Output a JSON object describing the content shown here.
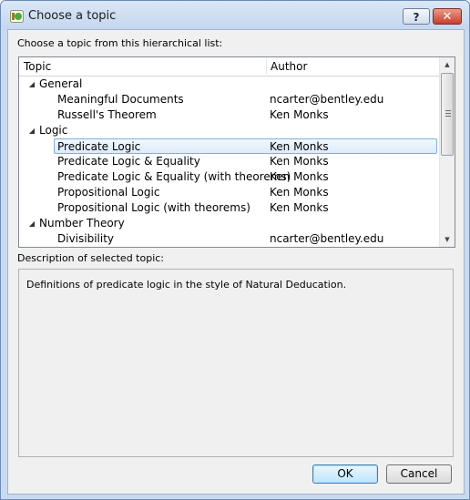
{
  "window": {
    "title": "Choose a topic",
    "help_glyph": "?",
    "close_glyph": "✕",
    "icon": "app-logo-icon"
  },
  "tree": {
    "prompt": "Choose a topic from this hierarchical list:",
    "columns": [
      "Topic",
      "Author"
    ],
    "rows": [
      {
        "type": "group",
        "topic": "General",
        "author": "",
        "expanded": true
      },
      {
        "type": "item",
        "topic": "Meaningful Documents",
        "author": "ncarter@bentley.edu"
      },
      {
        "type": "item",
        "topic": "Russell's Theorem",
        "author": "Ken Monks"
      },
      {
        "type": "group",
        "topic": "Logic",
        "author": "",
        "expanded": true
      },
      {
        "type": "item",
        "topic": "Predicate Logic",
        "author": "Ken Monks",
        "selected": true
      },
      {
        "type": "item",
        "topic": "Predicate Logic & Equality",
        "author": "Ken Monks"
      },
      {
        "type": "item",
        "topic": "Predicate Logic & Equality (with theorems)",
        "author": "Ken Monks"
      },
      {
        "type": "item",
        "topic": "Propositional Logic",
        "author": "Ken Monks"
      },
      {
        "type": "item",
        "topic": "Propositional Logic (with theorems)",
        "author": "Ken Monks"
      },
      {
        "type": "group",
        "topic": "Number Theory",
        "author": "",
        "expanded": true
      },
      {
        "type": "item",
        "topic": "Divisibility",
        "author": "ncarter@bentley.edu"
      }
    ]
  },
  "description": {
    "label": "Description of selected topic:",
    "text": "Definitions of predicate logic in the style of Natural Deducation."
  },
  "buttons": {
    "ok": "OK",
    "cancel": "Cancel"
  },
  "colors": {
    "selection_border": "#84acdd",
    "titlebar": "#c4d6ee",
    "close": "#c7402c"
  }
}
